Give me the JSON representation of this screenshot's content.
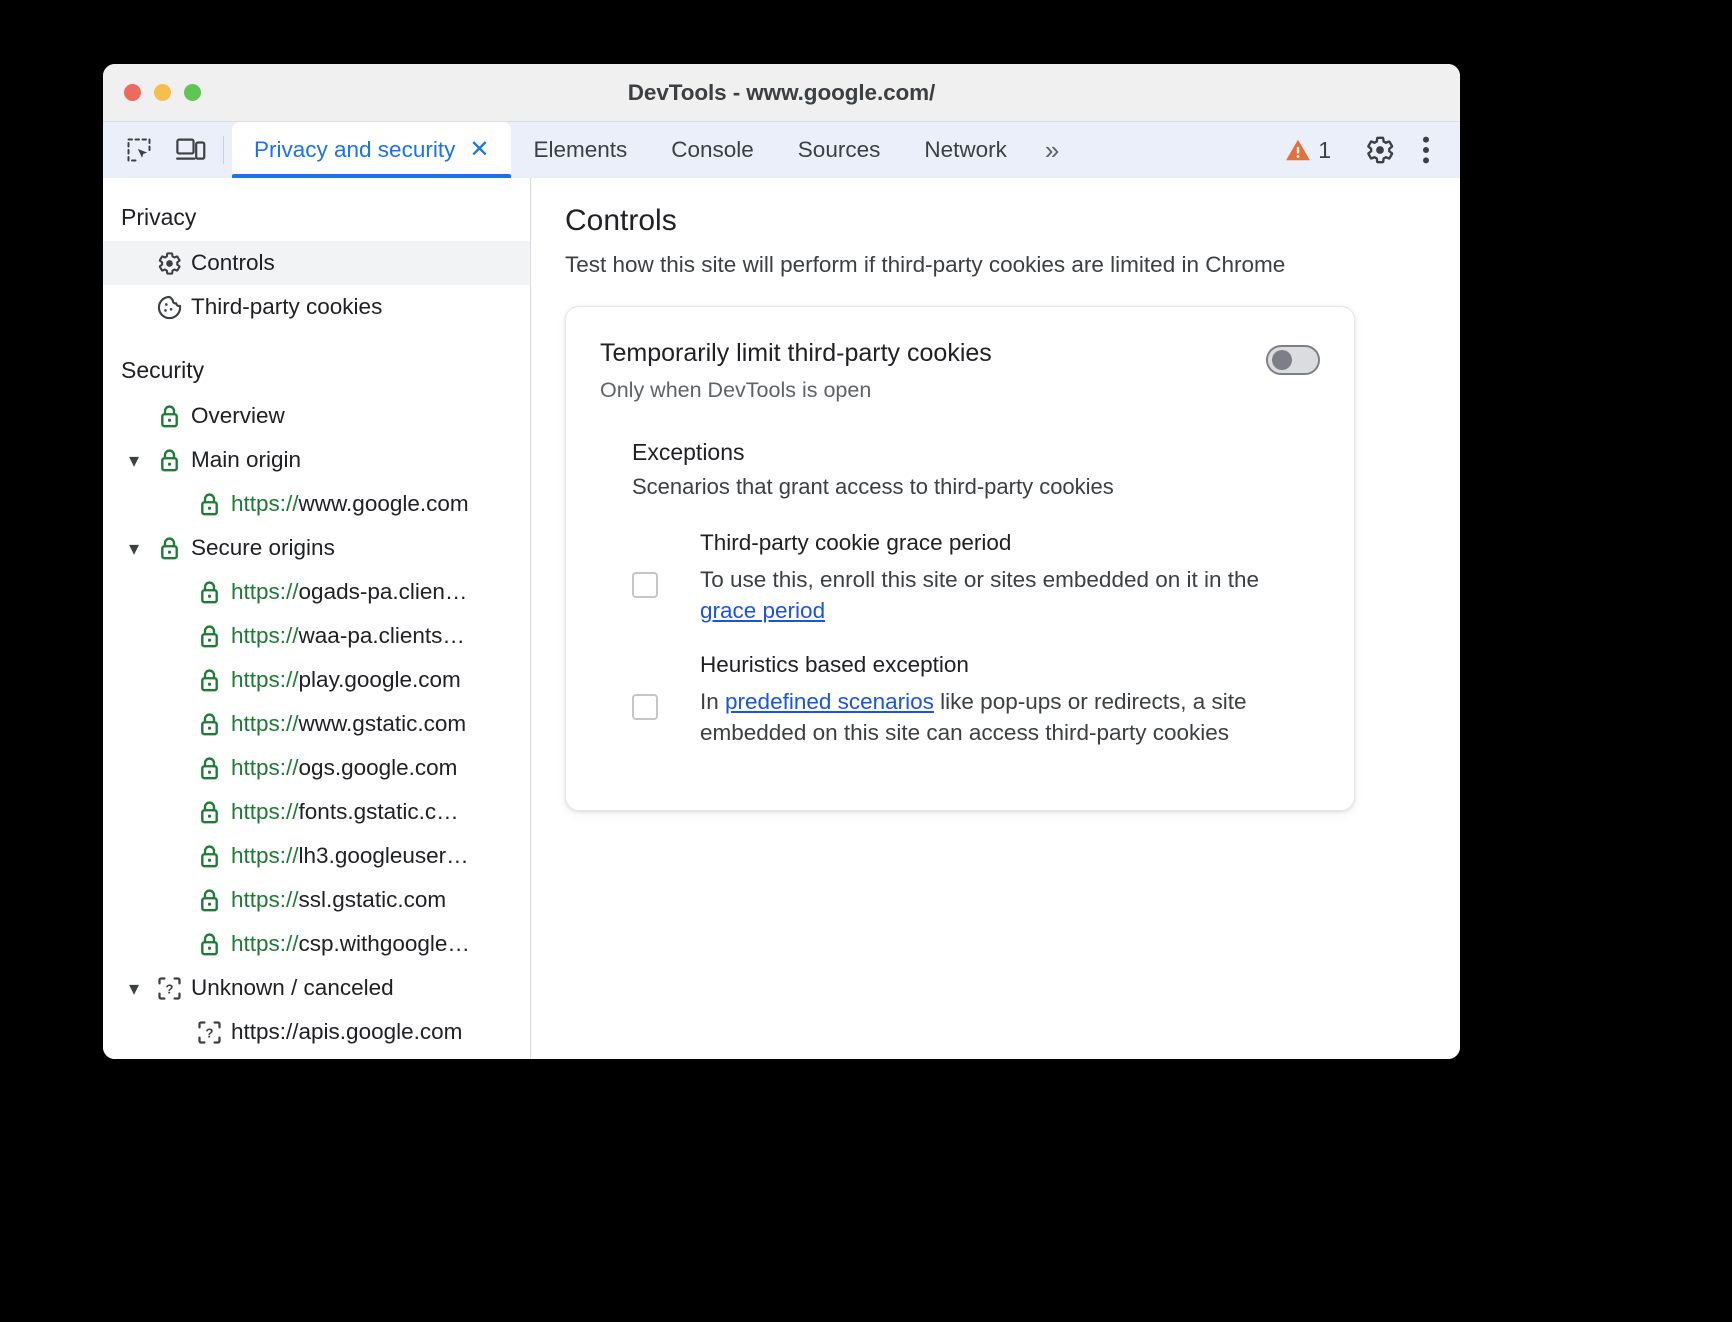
{
  "window": {
    "title": "DevTools - www.google.com/",
    "traffic_lights": [
      "close",
      "minimize",
      "maximize"
    ]
  },
  "toolbar": {
    "inspect_icon": "inspect-element-icon",
    "device_icon": "device-toolbar-icon",
    "tabs": [
      {
        "label": "Privacy and security",
        "active": true,
        "closable": true,
        "close_label": "✕"
      },
      {
        "label": "Elements",
        "active": false
      },
      {
        "label": "Console",
        "active": false
      },
      {
        "label": "Sources",
        "active": false
      },
      {
        "label": "Network",
        "active": false
      }
    ],
    "more_tabs_label": "»",
    "warning_count": "1",
    "warning_color": "#e2723b",
    "settings_icon": "gear-icon",
    "more_options_icon": "kebab-menu-icon"
  },
  "sidebar": {
    "groups": [
      {
        "title": "Privacy",
        "items": [
          {
            "label": "Controls",
            "icon": "gear-icon",
            "selected": true,
            "indent": 1,
            "twisty": ""
          },
          {
            "label": "Third-party cookies",
            "icon": "cookie-icon",
            "selected": false,
            "indent": 1,
            "twisty": ""
          }
        ]
      },
      {
        "title": "Security",
        "items": [
          {
            "label": "Overview",
            "icon": "lock-icon",
            "selected": false,
            "indent": 1,
            "twisty": ""
          },
          {
            "label": "Main origin",
            "icon": "lock-icon",
            "selected": false,
            "indent": 1,
            "twisty": "▾"
          },
          {
            "scheme": "https://",
            "host": "www.google.com",
            "icon": "lock-icon",
            "selected": false,
            "indent": 2,
            "twisty": ""
          },
          {
            "label": "Secure origins",
            "icon": "lock-icon",
            "selected": false,
            "indent": 1,
            "twisty": "▾"
          },
          {
            "scheme": "https://",
            "host": "ogads-pa.clien…",
            "icon": "lock-icon",
            "selected": false,
            "indent": 2,
            "twisty": ""
          },
          {
            "scheme": "https://",
            "host": "waa-pa.clients…",
            "icon": "lock-icon",
            "selected": false,
            "indent": 2,
            "twisty": ""
          },
          {
            "scheme": "https://",
            "host": "play.google.com",
            "icon": "lock-icon",
            "selected": false,
            "indent": 2,
            "twisty": ""
          },
          {
            "scheme": "https://",
            "host": "www.gstatic.com",
            "icon": "lock-icon",
            "selected": false,
            "indent": 2,
            "twisty": ""
          },
          {
            "scheme": "https://",
            "host": "ogs.google.com",
            "icon": "lock-icon",
            "selected": false,
            "indent": 2,
            "twisty": ""
          },
          {
            "scheme": "https://",
            "host": "fonts.gstatic.c…",
            "icon": "lock-icon",
            "selected": false,
            "indent": 2,
            "twisty": ""
          },
          {
            "scheme": "https://",
            "host": "lh3.googleuser…",
            "icon": "lock-icon",
            "selected": false,
            "indent": 2,
            "twisty": ""
          },
          {
            "scheme": "https://",
            "host": "ssl.gstatic.com",
            "icon": "lock-icon",
            "selected": false,
            "indent": 2,
            "twisty": ""
          },
          {
            "scheme": "https://",
            "host": "csp.withgoogle…",
            "icon": "lock-icon",
            "selected": false,
            "indent": 2,
            "twisty": ""
          },
          {
            "label": "Unknown / canceled",
            "icon": "unknown-icon",
            "selected": false,
            "indent": 1,
            "twisty": "▾"
          },
          {
            "plain": "https://apis.google.com",
            "icon": "unknown-icon",
            "selected": false,
            "indent": 2,
            "twisty": ""
          }
        ]
      }
    ]
  },
  "main": {
    "heading": "Controls",
    "subtitle": "Test how this site will perform if third-party cookies are limited in Chrome",
    "card": {
      "title": "Temporarily limit third-party cookies",
      "subtitle": "Only when DevTools is open",
      "toggle": {
        "state": "off",
        "label": "Temporarily limit third-party cookies toggle"
      },
      "exceptions": {
        "title": "Exceptions",
        "subtitle": "Scenarios that grant access to third-party cookies",
        "items": [
          {
            "name": "Third-party cookie grace period",
            "checked": false,
            "desc_before": "To use this, enroll this site or sites embedded on it in the ",
            "link": "grace period",
            "desc_after": ""
          },
          {
            "name": "Heuristics based exception",
            "checked": false,
            "desc_before": "In ",
            "link": "predefined scenarios",
            "desc_after": " like pop-ups or redirects, a site embedded on this site can access third-party cookies"
          }
        ]
      }
    }
  },
  "colors": {
    "accent": "#1a73e8",
    "link": "#1a56db",
    "secure_green": "#1e7a35",
    "warning_orange": "#e2723b",
    "tabstrip_bg": "#ebeffa"
  }
}
